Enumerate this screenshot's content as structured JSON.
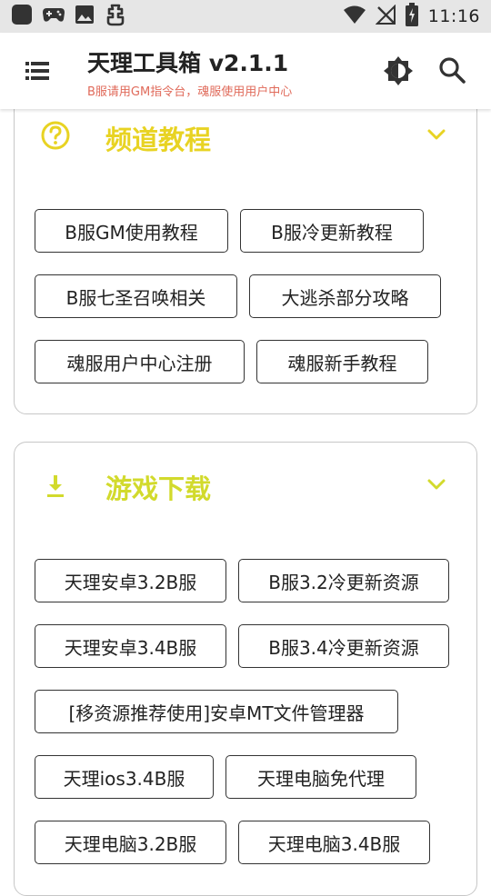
{
  "status_bar": {
    "time": "11:16",
    "left_icons": [
      "app-square-icon",
      "gamepad-icon",
      "image-icon",
      "bug-icon"
    ],
    "right_icons": [
      "wifi-icon",
      "no-signal-icon",
      "battery-icon"
    ]
  },
  "app_bar": {
    "title": "天理工具箱 v2.1.1",
    "subtitle": "B服请用GM指令台，魂服使用用户中心",
    "subtitle_color": "#e06a5a",
    "icons": [
      "menu-icon",
      "brightness-icon",
      "search-icon"
    ]
  },
  "sections": [
    {
      "title": "频道教程",
      "icon": "help-circle-icon",
      "title_color": "#e8d323",
      "buttons": [
        "B服GM使用教程",
        "B服冷更新教程",
        "B服七圣召唤相关",
        "大逃杀部分攻略",
        "魂服用户中心注册",
        "魂服新手教程"
      ]
    },
    {
      "title": "游戏下载",
      "icon": "download-icon",
      "title_color": "#d2da2c",
      "buttons": [
        "天理安卓3.2B服",
        "B服3.2冷更新资源",
        "天理安卓3.4B服",
        "B服3.4冷更新资源",
        "[移资源推荐使用]安卓MT文件管理器",
        "天理ios3.4B服",
        "天理电脑免代理",
        "天理电脑3.2B服",
        "天理电脑3.4B服"
      ]
    }
  ]
}
